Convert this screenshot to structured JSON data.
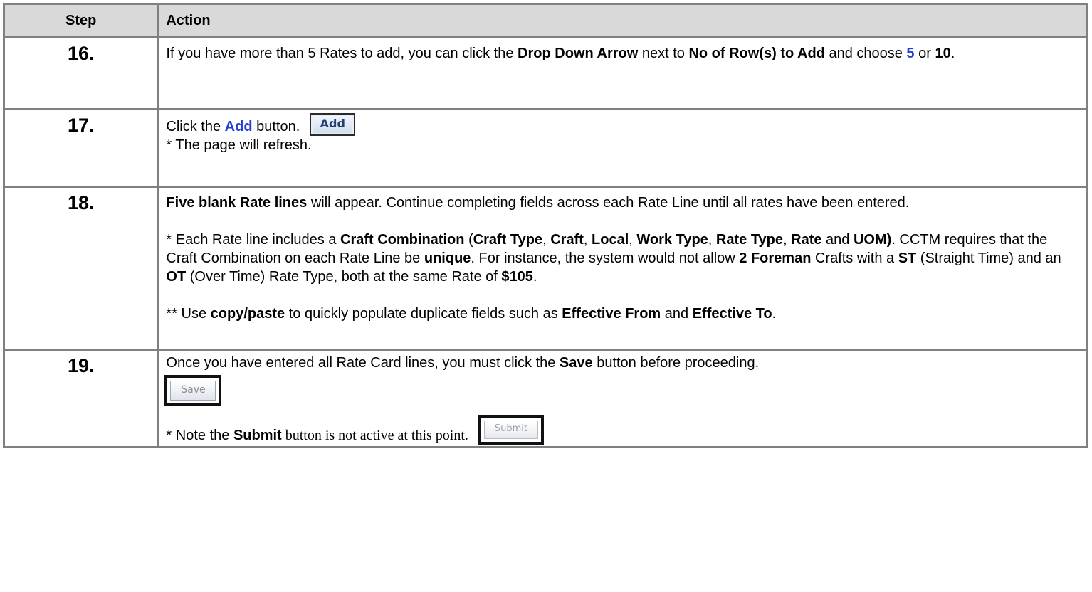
{
  "table": {
    "headers": {
      "step": "Step",
      "action": "Action"
    },
    "rows": [
      {
        "step": "16.",
        "text": {
          "a": "If you have more than 5 Rates to add, you can click the ",
          "b": "Drop Down Arrow",
          "c": " next to ",
          "d": "No of Row(s) to Add",
          "e": " and choose ",
          "f": "5",
          "g": " or ",
          "h": "10",
          "i": "."
        }
      },
      {
        "step": "17.",
        "text": {
          "a": "Click the ",
          "b": "Add",
          "c": " button.",
          "button": "Add",
          "note": "* The page will refresh."
        }
      },
      {
        "step": "18.",
        "p1": {
          "a": "Five blank Rate lines",
          "b": " will appear.  Continue completing fields across each Rate Line until all rates have been entered."
        },
        "p2": {
          "a": "* Each Rate line includes a ",
          "b": "Craft Combination",
          "c": " (",
          "d": "Craft Type",
          "e": ", ",
          "f": "Craft",
          "g": ", ",
          "h": "Local",
          "i": ", ",
          "j": "Work Type",
          "k": ", ",
          "l": "Rate Type",
          "m": ", ",
          "n": "Rate",
          "o": " and ",
          "p": "UOM)",
          "q": ".  CCTM requires that the Craft Combination on each Rate Line be ",
          "r": "unique",
          "s": ".   For instance, the system would  not allow ",
          "t": "2 Foreman",
          "u": " Crafts with a ",
          "v": "ST",
          "w": " (Straight Time) and an ",
          "x": "OT",
          "y": " (Over Time) Rate Type, both at the same Rate of ",
          "z": "$105",
          "end": "."
        },
        "p3": {
          "a": "** Use ",
          "b": "copy/paste",
          "c": " to quickly populate duplicate fields such as ",
          "d": "Effective From",
          "e": " and ",
          "f": "Effective To",
          "g": "."
        }
      },
      {
        "step": "19.",
        "p1": {
          "a": "Once you have entered all Rate Card lines, you must click the ",
          "b": "Save",
          "c": "   button before proceeding."
        },
        "save_button": "Save",
        "p2": {
          "a": "* Note the ",
          "b": "Submit",
          "c": " button is not active at this point."
        },
        "submit_button": "Submit"
      }
    ]
  },
  "colors": {
    "header_bg": "#d9d9d9",
    "border": "#808080",
    "link_blue": "#1f3fd6"
  }
}
